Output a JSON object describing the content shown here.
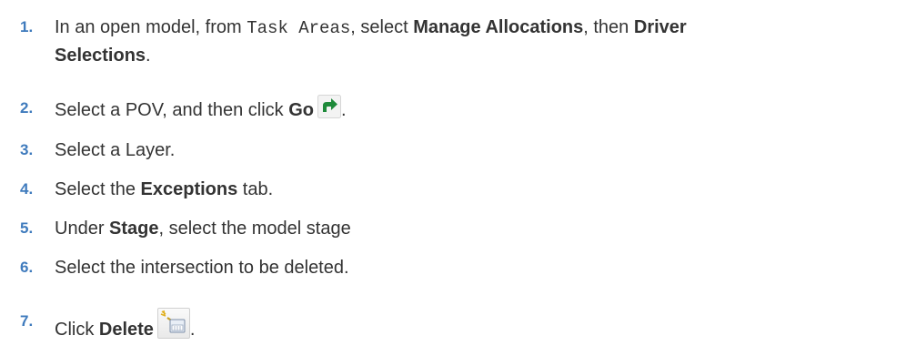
{
  "steps": [
    {
      "number": "1.",
      "parts": {
        "a": "In an open model, from ",
        "b": "Task Areas",
        "c": ", select ",
        "d": "Manage Allocations",
        "e": ", then ",
        "f": "Driver",
        "g": "Selections",
        "h": "."
      }
    },
    {
      "number": "2.",
      "parts": {
        "a": "Select a POV, and then click ",
        "b": "Go",
        "c": "."
      },
      "icon": "go-arrow-icon"
    },
    {
      "number": "3.",
      "parts": {
        "a": "Select a Layer."
      }
    },
    {
      "number": "4.",
      "parts": {
        "a": "Select the ",
        "b": "Exceptions",
        "c": " tab."
      }
    },
    {
      "number": "5.",
      "parts": {
        "a": "Under ",
        "b": "Stage",
        "c": ", select the model stage"
      }
    },
    {
      "number": "6.",
      "parts": {
        "a": "Select the intersection to be deleted."
      }
    },
    {
      "number": "7.",
      "parts": {
        "a": "Click ",
        "b": "Delete",
        "c": "."
      },
      "icon": "delete-icon"
    }
  ],
  "colors": {
    "step_number": "#3f7bbd",
    "text": "#333333",
    "go_arrow": "#1e8a3a"
  }
}
